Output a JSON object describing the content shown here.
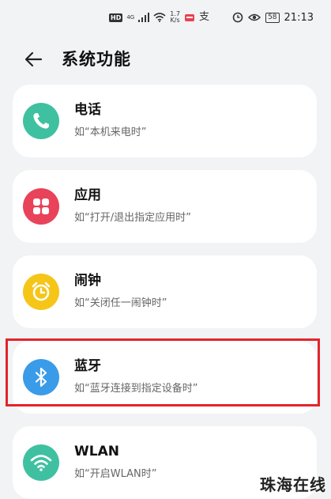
{
  "status_bar": {
    "hd": "HD",
    "signal_gen": "4G",
    "speed_value": "1.7",
    "speed_unit": "K/s",
    "battery": "58",
    "time": "21:13",
    "icons": [
      "signal-icon",
      "wifi-icon",
      "notification-icon",
      "alarm-icon",
      "eye-icon",
      "battery-icon"
    ]
  },
  "header": {
    "back_icon": "arrow-left-icon",
    "title": "系统功能"
  },
  "items": [
    {
      "title": "电话",
      "desc": "如“本机来电时”",
      "icon": "phone-icon",
      "color": "#3fc1a1"
    },
    {
      "title": "应用",
      "desc": "如“打开/退出指定应用时”",
      "icon": "apps-grid-icon",
      "color": "#e8435a"
    },
    {
      "title": "闹钟",
      "desc": "如“关闭任一闹钟时”",
      "icon": "alarm-clock-icon",
      "color": "#f5c518"
    },
    {
      "title": "蓝牙",
      "desc": "如“蓝牙连接到指定设备时”",
      "icon": "bluetooth-icon",
      "color": "#3a9be8"
    },
    {
      "title": "WLAN",
      "desc": "如“开启WLAN时”",
      "icon": "wifi-icon",
      "color": "#3fc1a1"
    }
  ],
  "highlight_color": "#e3242b",
  "watermark": "珠海在线"
}
